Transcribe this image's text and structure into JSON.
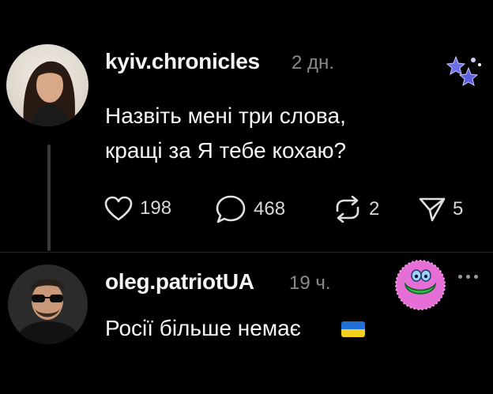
{
  "post": {
    "username": "kyiv.chronicles",
    "time": "2 дн.",
    "text_line1": "Назвіть мені три слова,",
    "text_line2": "кращі за Я тебе кохаю?",
    "actions": {
      "likes": "198",
      "comments": "468",
      "reposts": "2",
      "shares": "5"
    }
  },
  "reply": {
    "username": "oleg.patriotUA",
    "time": "19 ч.",
    "text": "Росії більше немає"
  },
  "colors": {
    "background": "#000000",
    "text": "#f5f5f5",
    "muted": "#8a8a8a",
    "flag_blue": "#1f6fd6",
    "flag_yellow": "#f4cf1c"
  }
}
